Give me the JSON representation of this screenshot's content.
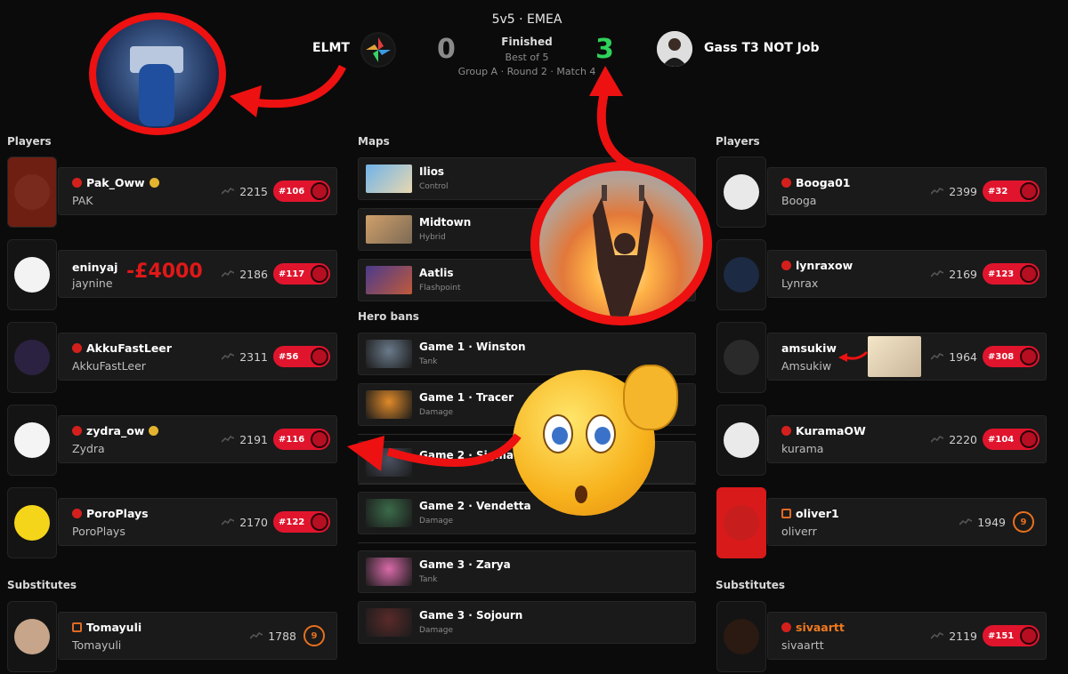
{
  "header": {
    "format": "5v5 · EMEA",
    "status": "Finished",
    "best_of": "Best of 5",
    "group_info": "Group A · Round 2 · Match 4",
    "team_left": {
      "name": "ELMT",
      "score": "0",
      "score_color": "#8a8a8a"
    },
    "team_right": {
      "name": "Gass T3 NOT Job",
      "score": "3",
      "score_color": "#2fd15a"
    }
  },
  "left": {
    "players_heading": "Players",
    "substitutes_heading": "Substitutes",
    "players": [
      {
        "name": "Pak_Oww",
        "real": "PAK",
        "sr": "2215",
        "rank": "#106",
        "verified": true
      },
      {
        "name": "eninyaj",
        "real": "jaynine",
        "sr": "2186",
        "rank": "#117",
        "note": "-£4000"
      },
      {
        "name": "AkkuFastLeer",
        "real": "AkkuFastLeer",
        "sr": "2311",
        "rank": "#56"
      },
      {
        "name": "zydra_ow",
        "real": "Zydra",
        "sr": "2191",
        "rank": "#116",
        "verified": true
      },
      {
        "name": "PoroPlays",
        "real": "PoroPlays",
        "sr": "2170",
        "rank": "#122"
      }
    ],
    "substitutes": [
      {
        "name": "Tomayuli",
        "real": "Tomayuli",
        "sr": "1788",
        "level": "9"
      }
    ]
  },
  "center": {
    "maps_heading": "Maps",
    "bans_heading": "Hero bans",
    "maps": [
      {
        "name": "Ilios",
        "mode": "Control"
      },
      {
        "name": "Midtown",
        "mode": "Hybrid"
      },
      {
        "name": "Aatlis",
        "mode": "Flashpoint"
      }
    ],
    "bans": [
      {
        "title": "Game 1 · Winston",
        "role": "Tank"
      },
      {
        "title": "Game 1 · Tracer",
        "role": "Damage"
      },
      {
        "title": "Game 2 · Sigma",
        "role": ""
      },
      {
        "title": "Game 2 · Vendetta",
        "role": "Damage"
      },
      {
        "title": "Game 3 · Zarya",
        "role": "Tank"
      },
      {
        "title": "Game 3 · Sojourn",
        "role": "Damage"
      }
    ]
  },
  "right": {
    "players_heading": "Players",
    "substitutes_heading": "Substitutes",
    "players": [
      {
        "name": "Booga01",
        "real": "Booga",
        "sr": "2399",
        "rank": "#32"
      },
      {
        "name": "lynraxow",
        "real": "Lynrax",
        "sr": "2169",
        "rank": "#123"
      },
      {
        "name": "amsukiw",
        "real": "Amsukiw",
        "sr": "1964",
        "rank": "#308"
      },
      {
        "name": "KuramaOW",
        "real": "kurama",
        "sr": "2220",
        "rank": "#104"
      },
      {
        "name": "oliver1",
        "real": "oliverr",
        "sr": "1949",
        "level": "9"
      }
    ],
    "substitutes": [
      {
        "name": "sivaartt",
        "real": "sivaartt",
        "sr": "2119",
        "rank": "#151",
        "name_color": "#f07a1f"
      }
    ]
  },
  "colors": {
    "accent_red": "#e0152d",
    "win_green": "#2fd15a",
    "level_orange": "#e8701e",
    "bg": "#0b0b0b"
  }
}
